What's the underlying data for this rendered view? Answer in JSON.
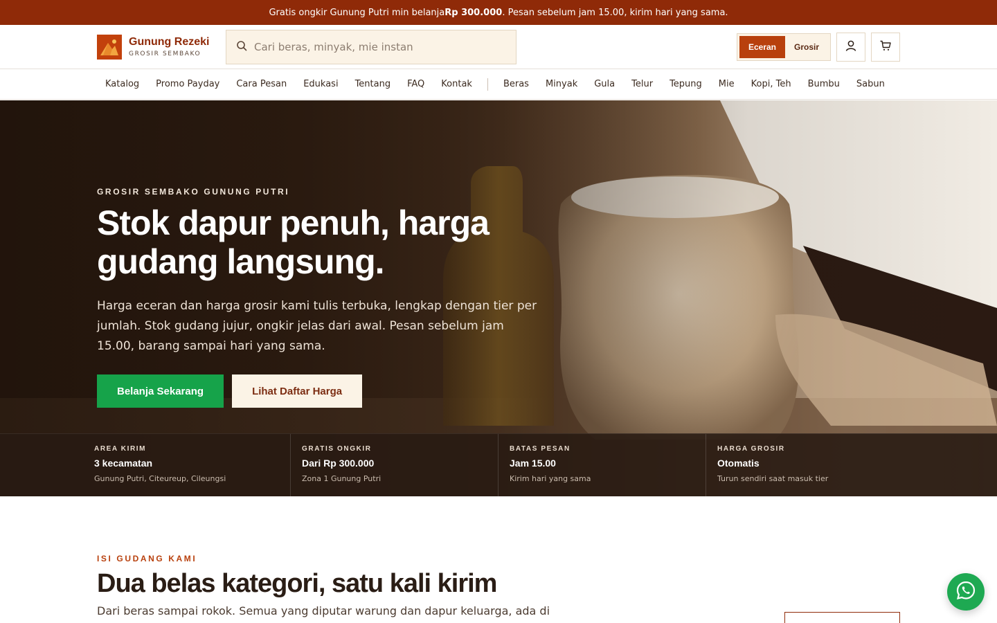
{
  "announcement": {
    "before": "Gratis ongkir Gunung Putri min belanja ",
    "amount": "Rp 300.000",
    "after": ". Pesan sebelum jam 15.00, kirim hari yang sama."
  },
  "brand": {
    "name": "Gunung Rezeki",
    "tagline": "GROSIR SEMBAKO"
  },
  "search": {
    "placeholder": "Cari beras, minyak, mie instan"
  },
  "mode_toggle": {
    "retail": "Eceran",
    "wholesale": "Grosir",
    "active": "retail"
  },
  "nav": {
    "main": [
      "Katalog",
      "Promo Payday",
      "Cara Pesan",
      "Edukasi",
      "Tentang",
      "FAQ",
      "Kontak"
    ],
    "categories": [
      "Beras",
      "Minyak",
      "Gula",
      "Telur",
      "Tepung",
      "Mie",
      "Kopi, Teh",
      "Bumbu",
      "Sabun"
    ]
  },
  "hero": {
    "eyebrow": "GROSIR SEMBAKO GUNUNG PUTRI",
    "title_line1": "Stok dapur penuh, harga",
    "title_line2": "gudang langsung.",
    "description": "Harga eceran dan harga grosir kami tulis terbuka, lengkap dengan tier per jumlah. Stok gudang jujur, ongkir jelas dari awal. Pesan sebelum jam 15.00, barang sampai hari yang sama.",
    "primary_cta": "Belanja Sekarang",
    "secondary_cta": "Lihat Daftar Harga"
  },
  "stats": [
    {
      "label": "AREA KIRIM",
      "value": "3 kecamatan",
      "note": "Gunung Putri, Citeureup, Cileungsi"
    },
    {
      "label": "GRATIS ONGKIR",
      "value": "Dari Rp 300.000",
      "note": "Zona 1 Gunung Putri"
    },
    {
      "label": "BATAS PESAN",
      "value": "Jam 15.00",
      "note": "Kirim hari yang sama"
    },
    {
      "label": "HARGA GROSIR",
      "value": "Otomatis",
      "note": "Turun sendiri saat masuk tier"
    }
  ],
  "categories_section": {
    "eyebrow": "ISI GUDANG KAMI",
    "title": "Dua belas kategori, satu kali kirim",
    "description": "Dari beras sampai rokok. Semua yang diputar warung dan dapur keluarga, ada di"
  },
  "colors": {
    "brand": "#8f2a08",
    "accent": "#b8400d",
    "cta_green": "#16a34a",
    "cream": "#fbf3e6"
  },
  "icons": [
    "search-icon",
    "user-icon",
    "cart-icon",
    "whatsapp-icon"
  ]
}
